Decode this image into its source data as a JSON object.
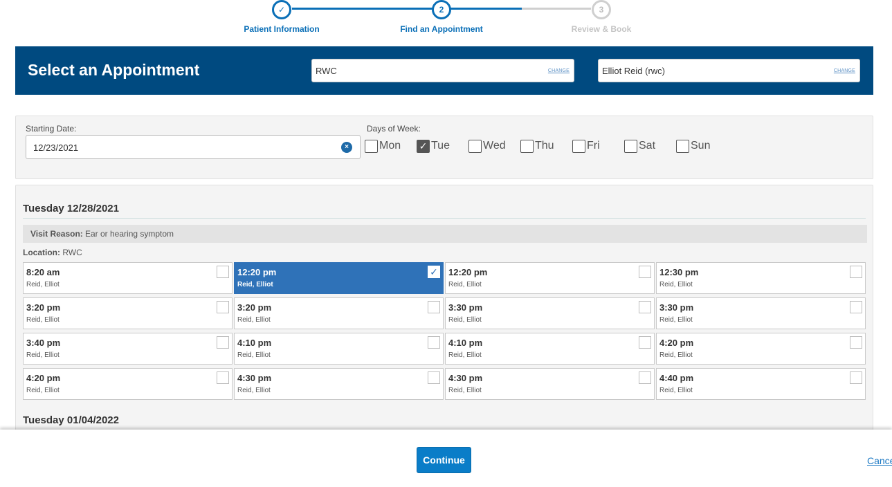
{
  "stepper": {
    "steps": [
      {
        "number": "✓",
        "label": "Patient Information",
        "state": "complete"
      },
      {
        "number": "2",
        "label": "Find an Appointment",
        "state": "current"
      },
      {
        "number": "3",
        "label": "Review & Book",
        "state": "upcoming"
      }
    ]
  },
  "header": {
    "title": "Select an Appointment",
    "location_value": "RWC",
    "provider_value": "Elliot Reid (rwc)",
    "change_label": "CHANGE"
  },
  "filter": {
    "starting_date_label": "Starting Date:",
    "starting_date_value": "12/23/2021",
    "clear_glyph": "×",
    "days_label": "Days of Week:",
    "days": [
      {
        "name": "Mon",
        "checked": false
      },
      {
        "name": "Tue",
        "checked": true
      },
      {
        "name": "Wed",
        "checked": false
      },
      {
        "name": "Thu",
        "checked": false
      },
      {
        "name": "Fri",
        "checked": false
      },
      {
        "name": "Sat",
        "checked": false
      },
      {
        "name": "Sun",
        "checked": false
      }
    ]
  },
  "results": {
    "groups": [
      {
        "date": "Tuesday 12/28/2021",
        "visit_reason_label": "Visit Reason:",
        "visit_reason": "Ear or hearing symptom",
        "location_label": "Location:",
        "location": "RWC",
        "slots": [
          {
            "time": "8:20 am",
            "provider": "Reid, Elliot",
            "selected": false
          },
          {
            "time": "12:20 pm",
            "provider": "Reid, Elliot",
            "selected": true
          },
          {
            "time": "12:20 pm",
            "provider": "Reid, Elliot",
            "selected": false
          },
          {
            "time": "12:30 pm",
            "provider": "Reid, Elliot",
            "selected": false
          },
          {
            "time": "3:20 pm",
            "provider": "Reid, Elliot",
            "selected": false
          },
          {
            "time": "3:20 pm",
            "provider": "Reid, Elliot",
            "selected": false
          },
          {
            "time": "3:30 pm",
            "provider": "Reid, Elliot",
            "selected": false
          },
          {
            "time": "3:30 pm",
            "provider": "Reid, Elliot",
            "selected": false
          },
          {
            "time": "3:40 pm",
            "provider": "Reid, Elliot",
            "selected": false
          },
          {
            "time": "4:10 pm",
            "provider": "Reid, Elliot",
            "selected": false
          },
          {
            "time": "4:10 pm",
            "provider": "Reid, Elliot",
            "selected": false
          },
          {
            "time": "4:20 pm",
            "provider": "Reid, Elliot",
            "selected": false
          },
          {
            "time": "4:20 pm",
            "provider": "Reid, Elliot",
            "selected": false
          },
          {
            "time": "4:30 pm",
            "provider": "Reid, Elliot",
            "selected": false
          },
          {
            "time": "4:30 pm",
            "provider": "Reid, Elliot",
            "selected": false
          },
          {
            "time": "4:40 pm",
            "provider": "Reid, Elliot",
            "selected": false
          }
        ]
      },
      {
        "date": "Tuesday 01/04/2022"
      }
    ]
  },
  "footer": {
    "continue_label": "Continue",
    "cancel_label": "Cance"
  },
  "colors": {
    "brand_blue": "#004a80",
    "accent_blue": "#0a6fb7",
    "selected_slot": "#2f72b8",
    "button_blue": "#0a7dc8"
  }
}
